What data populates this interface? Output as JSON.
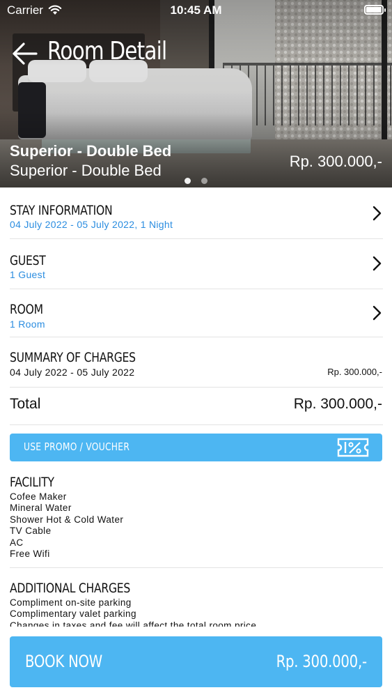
{
  "status_bar": {
    "carrier": "Carrier",
    "time": "10:45 AM"
  },
  "header": {
    "title": "Room Detail"
  },
  "hero": {
    "room_name": "Superior - Double Bed",
    "room_type": "Superior - Double Bed",
    "price": "Rp. 300.000,-",
    "slide_count": 2,
    "active_slide": 1
  },
  "stay_information": {
    "title": "STAY INFORMATION",
    "value": "04 July 2022 - 05 July 2022, 1 Night"
  },
  "guest": {
    "title": "GUEST",
    "value": "1 Guest"
  },
  "room": {
    "title": "ROOM",
    "value": "1 Room"
  },
  "summary": {
    "title": "SUMMARY OF CHARGES",
    "dates": "04 July 2022 - 05 July 2022",
    "price": "Rp. 300.000,-"
  },
  "total": {
    "label": "Total",
    "value": "Rp. 300.000,-"
  },
  "promo": {
    "label": "USE PROMO / VOUCHER",
    "icon": "voucher-percent-icon"
  },
  "facility": {
    "title": "FACILITY",
    "items": [
      "Cofee Maker",
      "Mineral Water",
      "Shower Hot & Cold Water",
      "TV Cable",
      "AC",
      "Free Wifi"
    ]
  },
  "additional_charges": {
    "title": "ADDITIONAL CHARGES",
    "items": [
      "Compliment on-site parking",
      "Complimentary valet parking",
      "Changes in taxes and fee will affect the total room price"
    ]
  },
  "book": {
    "label": "BOOK NOW",
    "price": "Rp. 300.000,-"
  },
  "colors": {
    "accent": "#4db6f2",
    "link": "#2b8de0",
    "divider": "#e3e3e3"
  }
}
